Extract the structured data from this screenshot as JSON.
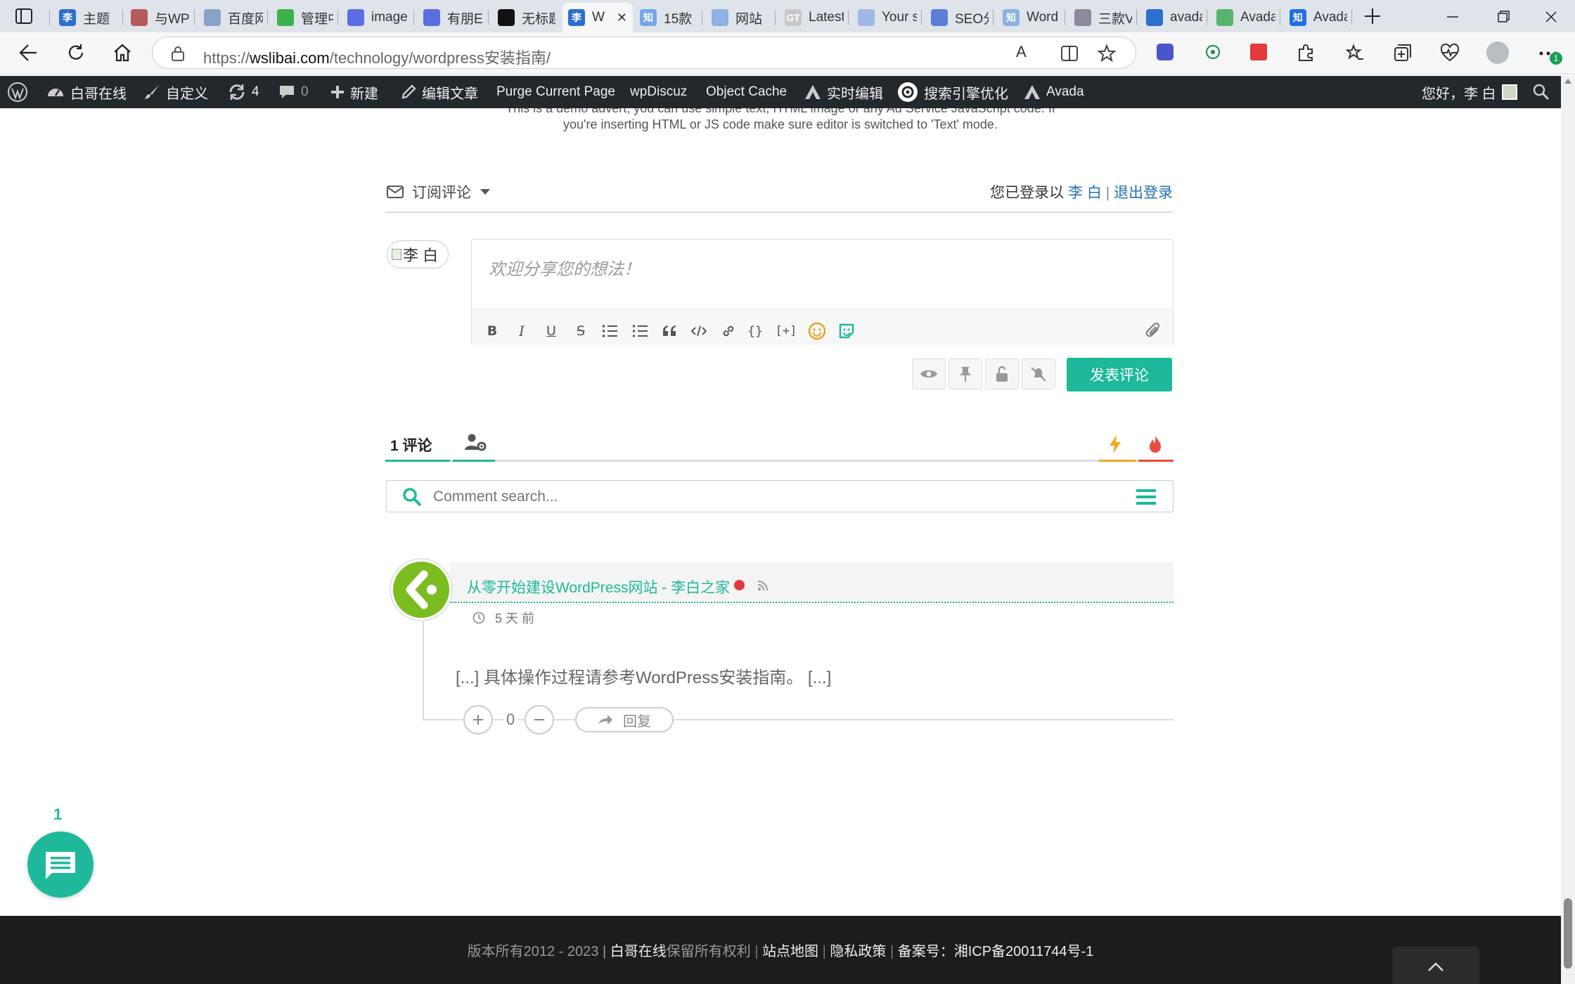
{
  "browser": {
    "tabs": [
      {
        "label": "主题",
        "fav_text": "李",
        "fav_color": "#2b6fcf"
      },
      {
        "label": "与WP",
        "fav_text": "",
        "fav_color": "#b55b5b"
      },
      {
        "label": "百度网",
        "fav_text": "",
        "fav_color": "#8aa2c8"
      },
      {
        "label": "管理中",
        "fav_text": "",
        "fav_color": "#3bb34a"
      },
      {
        "label": "image",
        "fav_text": "",
        "fav_color": "#5b6ee1"
      },
      {
        "label": "有朋E",
        "fav_text": "",
        "fav_color": "#5b6ee1"
      },
      {
        "label": "无标题",
        "fav_text": "",
        "fav_color": "#111111"
      },
      {
        "label": "W",
        "fav_text": "李",
        "fav_color": "#2b6fcf"
      },
      {
        "label": "15款",
        "fav_text": "知",
        "fav_color": "#76a6e6"
      },
      {
        "label": "网站",
        "fav_text": "",
        "fav_color": "#8db0e6"
      },
      {
        "label": "Latest",
        "fav_text": "GT",
        "fav_color": "#c8c8c8"
      },
      {
        "label": "Your s",
        "fav_text": "",
        "fav_color": "#9fb8e6"
      },
      {
        "label": "SEO分",
        "fav_text": "",
        "fav_color": "#5b7ed8"
      },
      {
        "label": "Word",
        "fav_text": "知",
        "fav_color": "#8bb2e6"
      },
      {
        "label": "三款V",
        "fav_text": "",
        "fav_color": "#8a8a9a"
      },
      {
        "label": "avada",
        "fav_text": "",
        "fav_color": "#2b6fcf"
      },
      {
        "label": "Avada",
        "fav_text": "",
        "fav_color": "#55b56f"
      },
      {
        "label": "Avada",
        "fav_text": "知",
        "fav_color": "#1f6fe0"
      }
    ],
    "url_prefix": "https://",
    "url_domain": "wslibai.com",
    "url_path": "/technology/wordpress安装指南/",
    "read_aloud": "A",
    "ext_badge": "1"
  },
  "adminbar": {
    "site_name": "白哥在线",
    "customize": "自定义",
    "updates_count": "4",
    "comments_count": "0",
    "new": "新建",
    "edit_post": "编辑文章",
    "purge": "Purge Current Page",
    "wpdiscuz": "wpDiscuz",
    "object_cache": "Object Cache",
    "live_edit": "实时编辑",
    "seo": "搜索引擎优化",
    "avada": "Avada",
    "greeting": "您好，李 白"
  },
  "advert": {
    "line1": "This is a demo advert, you can use simple text, HTML image or any Ad Service JavaScript code. If",
    "line2": "you're inserting HTML or JS code make sure editor is switched to 'Text' mode."
  },
  "comments": {
    "subscribe_label": "订阅评论",
    "logged_in_prefix": "您已登录以",
    "user_name": "李 白",
    "separator": "|",
    "logout": "退出登录",
    "avatar_alt": "李 白",
    "editor_placeholder": "欢迎分享您的想法！",
    "submit": "发表评论",
    "count_number": "1",
    "count_label": "评论",
    "search_placeholder": "Comment search...",
    "items": [
      {
        "author": "从零开始建设WordPress网站 - 李白之家",
        "time": "5 天 前",
        "body": "[...] 具体操作过程请参考WordPress安装指南。 [...]",
        "votes": "0",
        "reply": "回复"
      }
    ],
    "bubble_count": "1"
  },
  "footer": {
    "copyright": "版本所有2012 - 2023 | ",
    "site_link": "白哥在线",
    "rights": "保留所有权利",
    "sitemap": "站点地图",
    "privacy": "隐私政策",
    "icp_prefix": "备案号：",
    "icp": "湘ICP备20011744号-1"
  },
  "colors": {
    "accent": "#1db99a",
    "adminbar": "#23282d",
    "footer": "#1c1c1c",
    "link": "#2271b1"
  }
}
